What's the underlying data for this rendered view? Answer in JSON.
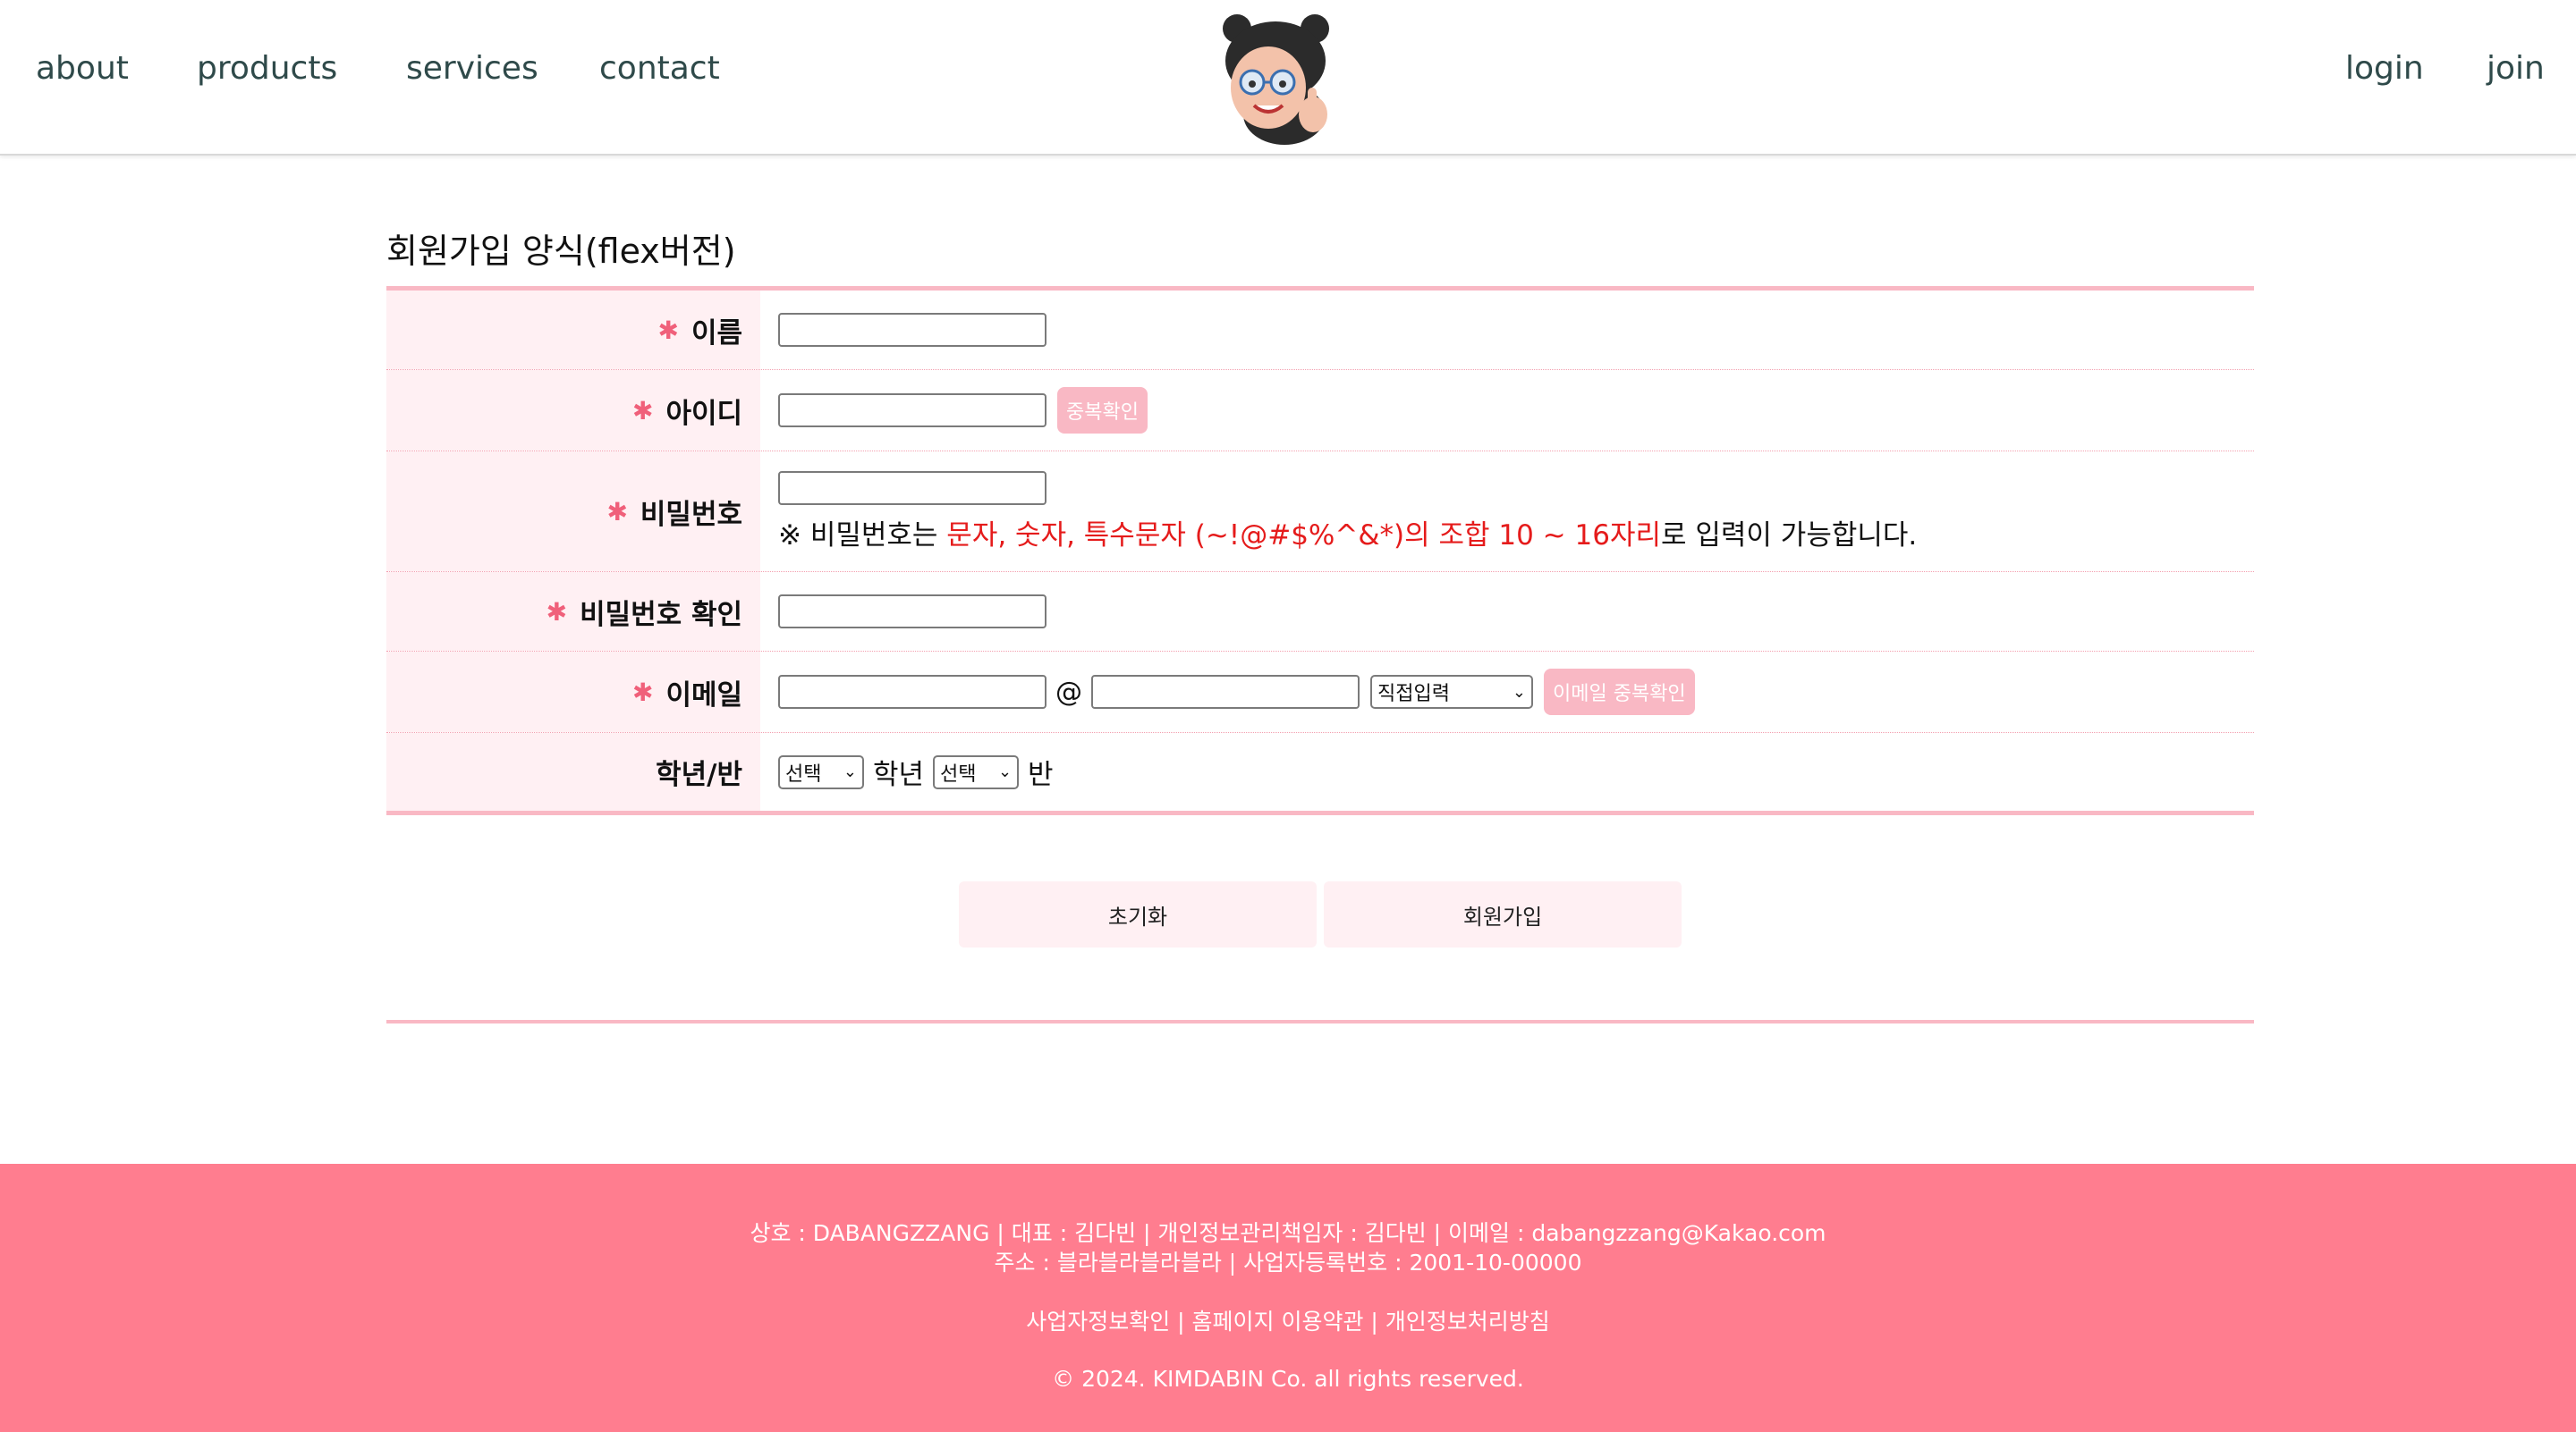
{
  "header": {
    "nav_left": [
      "about",
      "products",
      "services",
      "contact"
    ],
    "nav_right": [
      "login",
      "join"
    ]
  },
  "form": {
    "title": "회원가입 양식(flex버전)",
    "required_mark": "✱",
    "name_label": "이름",
    "id_label": "아이디",
    "id_check_button": "중복확인",
    "password_label": "비밀번호",
    "password_hint_prefix": "※ 비밀번호는 ",
    "password_hint_red": "문자, 숫자, 특수문자 (~!@#$%^&*)의 조합 10 ~ 16자리",
    "password_hint_suffix": "로 입력이 가능합니다.",
    "password_confirm_label": "비밀번호 확인",
    "email_label": "이메일",
    "email_at": "@",
    "email_domain_select": "직접입력",
    "email_check_button": "이메일 중복확인",
    "grade_label": "학년/반",
    "grade_select": "선택",
    "grade_unit": "학년",
    "class_select": "선택",
    "class_unit": "반"
  },
  "actions": {
    "reset_label": "초기화",
    "submit_label": "회원가입"
  },
  "footer": {
    "info_line1": "상호 : DABANGZZANG | 대표 : 김다빈 | 개인정보관리책임자 : 김다빈 | 이메일 : dabangzzang@Kakao.com",
    "info_line2": "주소 : 블라블라블라블라 | 사업자등록번호 : 2001-10-00000",
    "links": "사업자정보확인 | 홈페이지 이용약관 | 개인정보처리방침",
    "copyright": "© 2024. KIMDABIN Co. all rights reserved."
  },
  "colors": {
    "accent_pink": "#f9b8c4",
    "label_bg": "#fff0f3",
    "footer_bg": "#ff7d8f",
    "hint_red": "#e51b1b",
    "nav_text": "#2f4a4a"
  }
}
